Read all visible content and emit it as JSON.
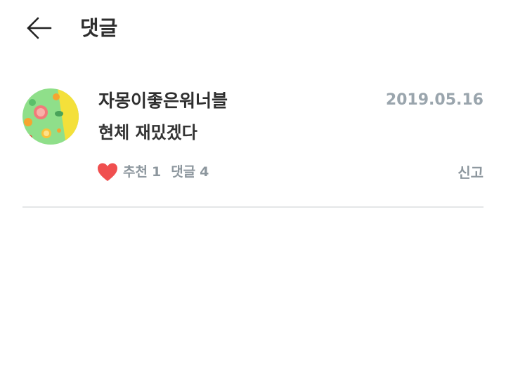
{
  "header": {
    "title": "댓글",
    "back_icon": "arrow-left-icon"
  },
  "comment": {
    "username": "자몽이좋은워너블",
    "date": "2019.05.16",
    "text": "현체 재밌겠다",
    "avatar_icon": "citrus-fruit-avatar",
    "like_label": "추천",
    "like_count": "1",
    "reply_label": "댓글",
    "reply_count": "4",
    "report_label": "신고",
    "heart_color": "#f04f4f"
  },
  "colors": {
    "title": "#2e2e2e",
    "date": "#9aa5ad",
    "meta": "#8d979e",
    "divider": "#e4e6e8"
  }
}
